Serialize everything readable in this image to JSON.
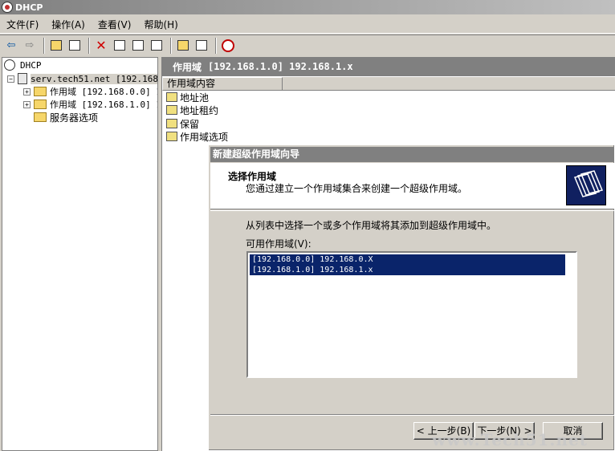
{
  "window": {
    "title": "DHCP"
  },
  "menu": [
    "文件(F)",
    "操作(A)",
    "查看(V)",
    "帮助(H)"
  ],
  "tree": {
    "root": "DHCP",
    "server": "serv.tech51.net [192.168.",
    "children": [
      "作用域 [192.168.0.0] 1",
      "作用域 [192.168.1.0] 1",
      "服务器选项"
    ]
  },
  "rightpane": {
    "header_label": "作用域",
    "header_value": "[192.168.1.0] 192.168.1.x",
    "column": "作用域内容",
    "items": [
      "地址池",
      "地址租约",
      "保留",
      "作用域选项"
    ]
  },
  "wizard": {
    "title": "新建超级作用域向导",
    "heading": "选择作用域",
    "subtitle": "您通过建立一个作用域集合来创建一个超级作用域。",
    "instruction": "从列表中选择一个或多个作用域将其添加到超级作用域中。",
    "list_label": "可用作用域(V):",
    "scopes": [
      "[192.168.0.0] 192.168.0.X",
      "[192.168.1.0] 192.168.1.x"
    ],
    "back": "< 上一步(B)",
    "next": "下一步(N) >",
    "cancel": "取消"
  },
  "watermark": "www.Tech51.net",
  "colors": {
    "selection": "#0a246a",
    "header": "#808080"
  }
}
